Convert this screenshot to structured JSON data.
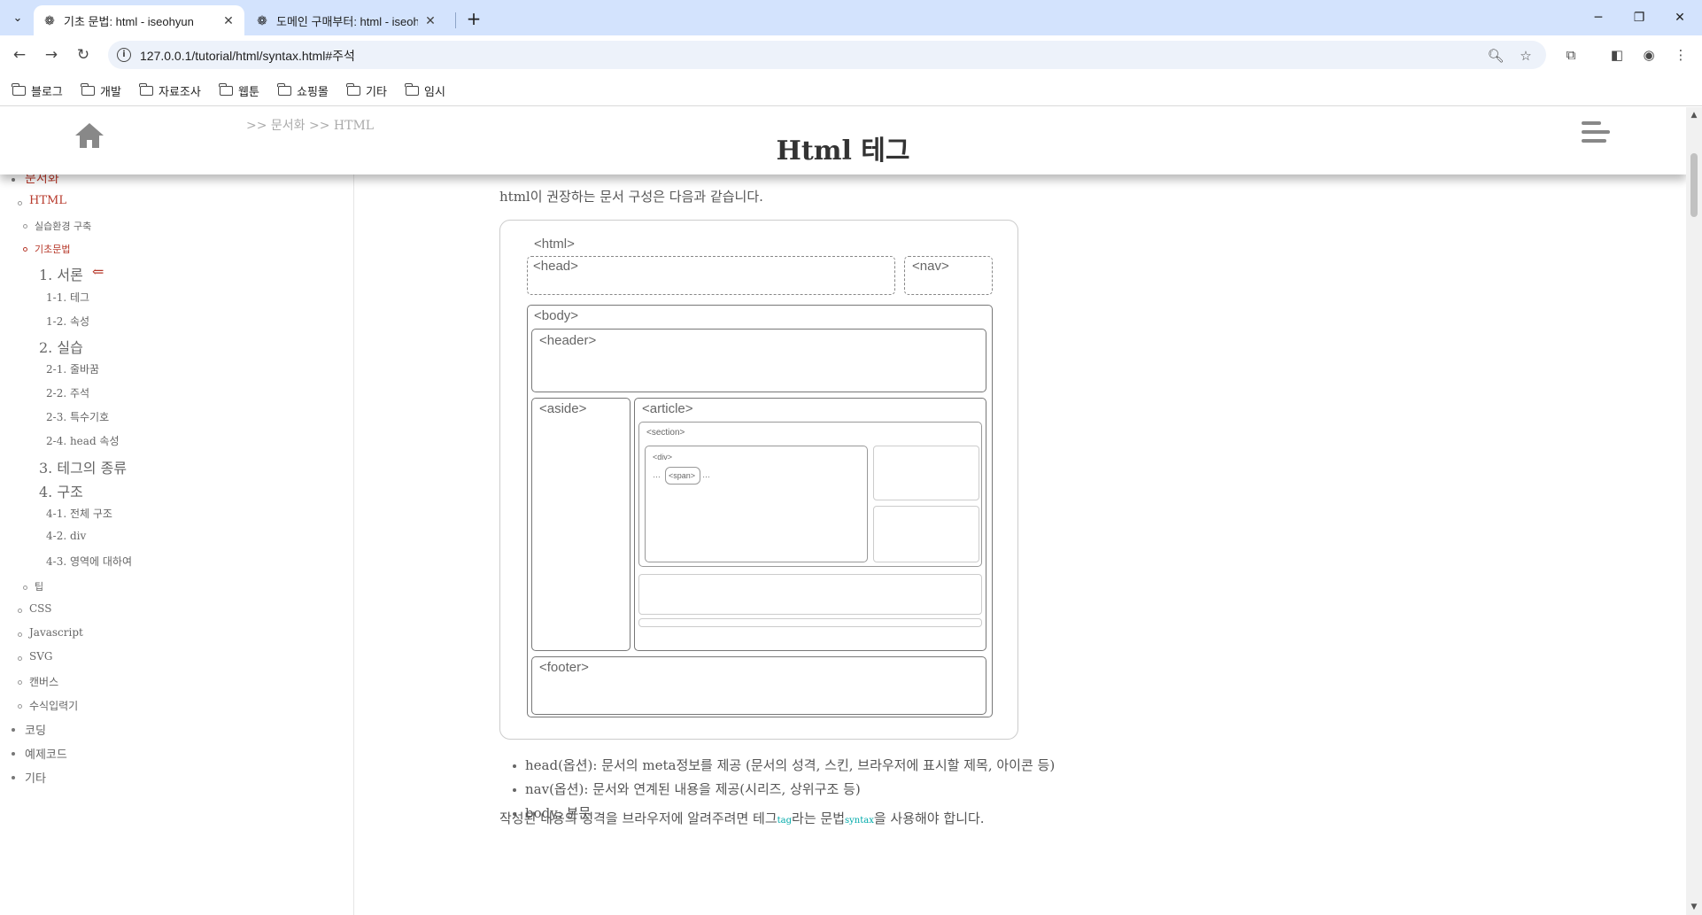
{
  "browser": {
    "tabs": [
      {
        "title": "기초 문법: html - iseohyun",
        "active": true
      },
      {
        "title": "도메인 구매부터: html - iseohyun",
        "active": false
      }
    ],
    "url": "127.0.0.1/tutorial/html/syntax.html#주석",
    "bookmarks": [
      "블로그",
      "개발",
      "자료조사",
      "웹툰",
      "쇼핑몰",
      "기타",
      "임시"
    ]
  },
  "header": {
    "breadcrumb": ">> 문서화 >> HTML",
    "title": "Html 테그"
  },
  "sidebar": {
    "top": "문서화",
    "html": "HTML",
    "env": "실습환경 구축",
    "basic": "기초문법",
    "s1": "1. 서론",
    "arrow": "⇐",
    "s1_1": "1-1. 테그",
    "s1_2": "1-2. 속성",
    "s2": "2. 실습",
    "s2_1": "2-1. 줄바꿈",
    "s2_2": "2-2. 주석",
    "s2_3": "2-3. 특수기호",
    "s2_4": "2-4. head 속성",
    "s3": "3. 테그의 종류",
    "s4": "4. 구조",
    "s4_1": "4-1. 전체 구조",
    "s4_2": "4-2. div",
    "s4_3": "4-3. 영역에 대하여",
    "tip": "팁",
    "css": "CSS",
    "js": "Javascript",
    "svg": "SVG",
    "canvas": "캔버스",
    "formula": "수식입력기",
    "coding": "코딩",
    "example": "예제코드",
    "etc": "기타"
  },
  "content": {
    "intro": "html이 권장하는 문서 구성은 다음과 같습니다.",
    "diagram": {
      "html": "<html>",
      "head": "<head>",
      "nav": "<nav>",
      "body": "<body>",
      "header": "<header>",
      "aside": "<aside>",
      "article": "<article>",
      "section": "<section>",
      "div": "<div>",
      "span": "<span>",
      "dots_left": "…",
      "dots_right": "…",
      "footer": "<footer>"
    },
    "list": [
      "head(옵션): 문서의 meta정보를 제공 (문서의 성격, 스킨, 브라우저에 표시할 제목, 아이콘 등)",
      "nav(옵션): 문서와 연계된 내용을 제공(시리즈, 상위구조 등)",
      "body: 본문"
    ],
    "outro": {
      "a": "작성된 내용의 성격을 브라우저에 알려주려면 테그",
      "tag": "tag",
      "b": "라는 문법",
      "syntax": "syntax",
      "c": "을 사용해야 합니다."
    }
  }
}
